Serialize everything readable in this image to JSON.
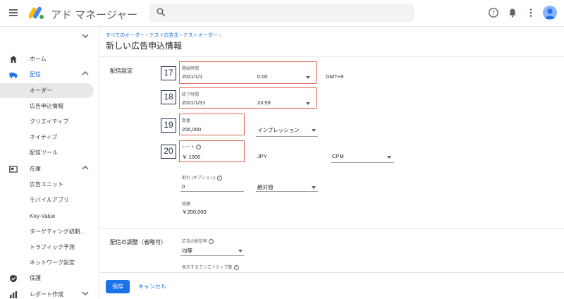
{
  "app": {
    "title": "アド マネージャー"
  },
  "search": {
    "placeholder": ""
  },
  "sidebar": {
    "items": [
      {
        "label": "ホーム"
      },
      {
        "label": "配信"
      },
      {
        "label": "オーダー"
      },
      {
        "label": "広告申込情報"
      },
      {
        "label": "クリエイティブ"
      },
      {
        "label": "ネイティブ"
      },
      {
        "label": "配信ツール"
      },
      {
        "label": "在庫"
      },
      {
        "label": "広告ユニット"
      },
      {
        "label": "モバイルアプリ"
      },
      {
        "label": "Key-Value"
      },
      {
        "label": "ターゲティング初期..."
      },
      {
        "label": "トラフィック予測"
      },
      {
        "label": "ネットワーク設定"
      },
      {
        "label": "保護"
      },
      {
        "label": "レポート作成"
      }
    ]
  },
  "breadcrumb": [
    "すべてのオーダー",
    "テスト広告主",
    "テストオーダー"
  ],
  "page": {
    "title": "新しい広告申込情報"
  },
  "delivery": {
    "section_label": "配信設定",
    "start": {
      "badge": "17",
      "label": "開始時間",
      "date": "2021/1/1",
      "time": "0:00",
      "tz": "GMT+9"
    },
    "end": {
      "badge": "18",
      "label": "終了時間",
      "date": "2021/1/31",
      "time": "23:59"
    },
    "quantity": {
      "badge": "19",
      "label": "数量",
      "value": "200,000",
      "unit": "インプレッション"
    },
    "rate": {
      "badge": "20",
      "label": "レート",
      "value": "￥ 1000",
      "currency": "JPY",
      "model": "CPM"
    },
    "discount": {
      "label": "割引 (オプション)",
      "value": "0",
      "type": "絶対値"
    },
    "total": {
      "label": "総額",
      "value": "￥200,000"
    }
  },
  "adjust": {
    "section_label": "配信の調整（省略可）",
    "rate_label": "広告の配信率",
    "rate_value": "均等",
    "creatives_label": "表示するクリエイティブ数"
  },
  "footer": {
    "save": "保存",
    "cancel": "キャンセル"
  },
  "colors": {
    "accent": "#1a73e8",
    "highlight": "#e06655",
    "badge": "#1d2a4d"
  }
}
